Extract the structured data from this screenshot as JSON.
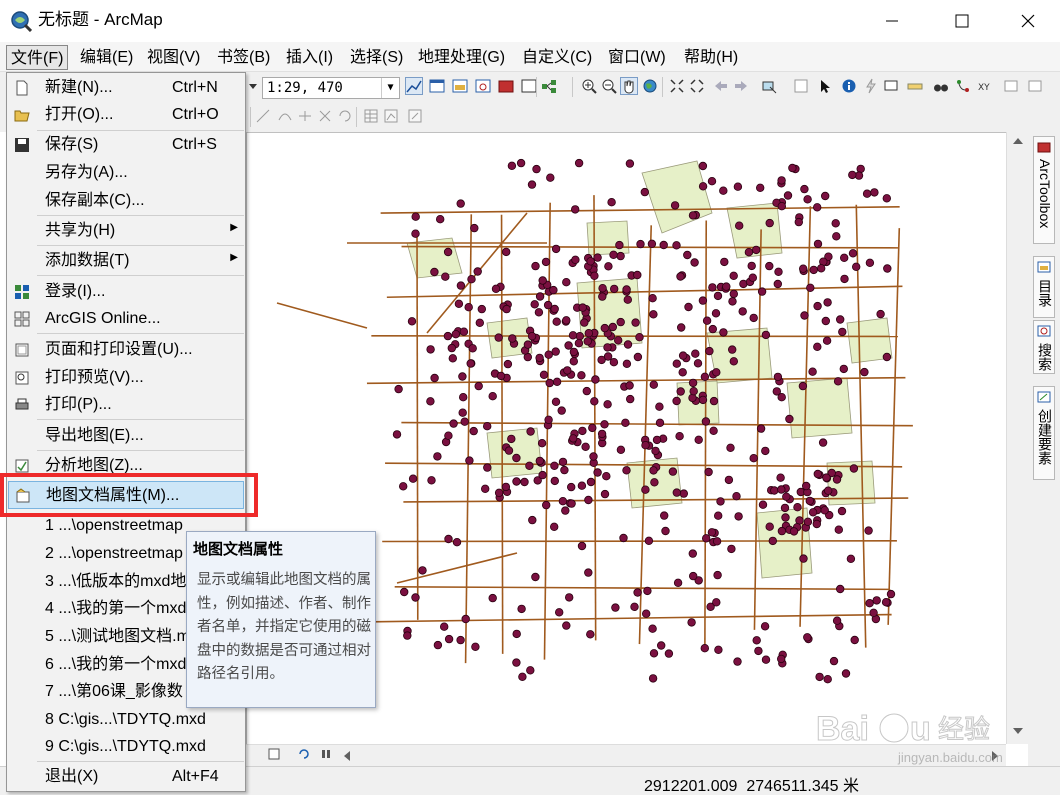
{
  "window": {
    "title": "无标题 - ArcMap",
    "minimize_glyph": "—",
    "maximize_glyph": "☐",
    "close_glyph": "✕"
  },
  "menubar": {
    "items": [
      "文件(F)",
      "编辑(E)",
      "视图(V)",
      "书签(B)",
      "插入(I)",
      "选择(S)",
      "地理处理(G)",
      "自定义(C)",
      "窗口(W)",
      "帮助(H)"
    ]
  },
  "toolbar": {
    "scale_value": "1:29, 470"
  },
  "file_menu": {
    "items": [
      {
        "label": "新建(N)...",
        "shortcut": "Ctrl+N",
        "icon": "new-document-icon"
      },
      {
        "label": "打开(O)...",
        "shortcut": "Ctrl+O",
        "icon": "open-folder-icon"
      },
      {
        "label": "保存(S)",
        "shortcut": "Ctrl+S",
        "icon": "save-icon"
      },
      {
        "label": "另存为(A)...",
        "shortcut": ""
      },
      {
        "label": "保存副本(C)...",
        "shortcut": ""
      },
      {
        "label": "共享为(H)",
        "shortcut": "",
        "submenu": true
      },
      {
        "label": "添加数据(T)",
        "shortcut": "",
        "submenu": true
      },
      {
        "label": "登录(I)...",
        "shortcut": "",
        "icon": "sign-in-icon"
      },
      {
        "label": "ArcGIS Online...",
        "shortcut": "",
        "icon": "arcgis-online-icon"
      },
      {
        "label": "页面和打印设置(U)...",
        "shortcut": "",
        "icon": "page-setup-icon"
      },
      {
        "label": "打印预览(V)...",
        "shortcut": "",
        "icon": "print-preview-icon"
      },
      {
        "label": "打印(P)...",
        "shortcut": "",
        "icon": "print-icon"
      },
      {
        "label": "导出地图(E)...",
        "shortcut": ""
      },
      {
        "label": "分析地图(Z)...",
        "shortcut": "",
        "icon": "analyze-map-icon"
      },
      {
        "label": "地图文档属性(M)...",
        "shortcut": "",
        "icon": "document-properties-icon",
        "highlighted": true
      },
      {
        "label": "1 ...\\openstreetmap",
        "shortcut": ""
      },
      {
        "label": "2 ...\\openstreetmap",
        "shortcut": ""
      },
      {
        "label": "3 ...\\低版本的mxd地",
        "shortcut": ""
      },
      {
        "label": "4 ...\\我的第一个mxd",
        "shortcut": ""
      },
      {
        "label": "5 ...\\测试地图文档.m",
        "shortcut": ""
      },
      {
        "label": "6 ...\\我的第一个mxd",
        "shortcut": ""
      },
      {
        "label": "7 ...\\第06课_影像数",
        "shortcut": ""
      },
      {
        "label": "8 C:\\gis...\\TDYTQ.mxd",
        "shortcut": ""
      },
      {
        "label": "9 C:\\gis...\\TDYTQ.mxd",
        "shortcut": ""
      },
      {
        "label": "退出(X)",
        "shortcut": "Alt+F4"
      }
    ]
  },
  "tooltip": {
    "title": "地图文档属性",
    "body": "显示或编辑此地图文档的属性，例如描述、作者、制作者名单，并指定它使用的磁盘中的数据是否可通过相对路径名引用。"
  },
  "right_dock": {
    "tabs": [
      "ArcToolbox",
      "目录",
      "搜索",
      "创建要素"
    ]
  },
  "status": {
    "coords": "2912201.009  2746511.345 米"
  },
  "watermark": {
    "brand": "Baidu经验",
    "url": "jingyan.baidu.com"
  },
  "colors": {
    "point_fill": "#7a1040",
    "point_stroke": "#2a0010",
    "road": "#a05a1e",
    "polygon_fill": "#e6f0c8",
    "polygon_stroke": "#9a9a7a",
    "highlight_red": "#ee2a2a",
    "menu_selected": "#cde6f7"
  }
}
